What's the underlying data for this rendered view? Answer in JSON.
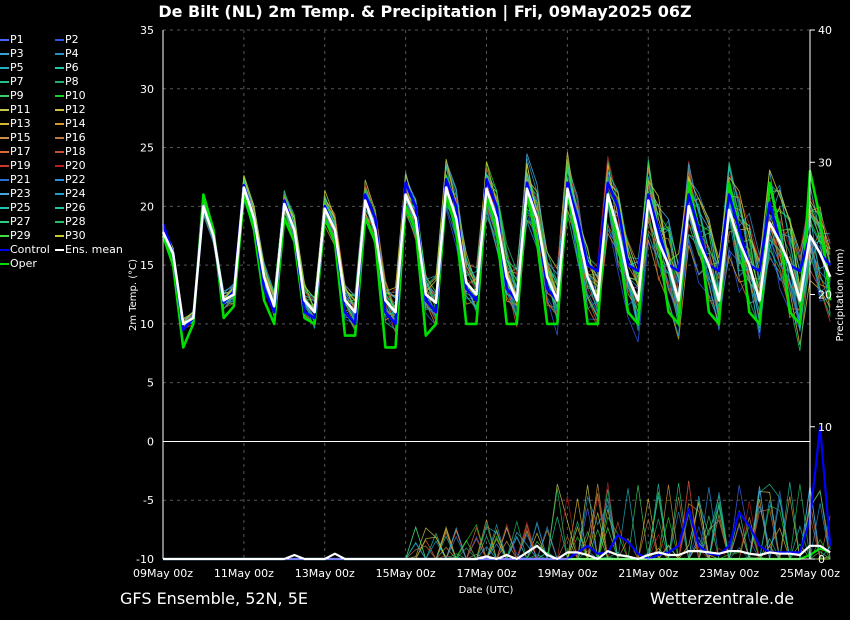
{
  "header": {
    "title": "De Bilt  (NL)  2m Temp. & Precipitation | Fri, 09May2025 06Z"
  },
  "footer": {
    "left": "GFS Ensemble, 52N, 5E",
    "right": "Wetterzentrale.de"
  },
  "legend": [
    {
      "label": "P1",
      "color": "#4466ff"
    },
    {
      "label": "P2",
      "color": "#2f55e0"
    },
    {
      "label": "P3",
      "color": "#3aa0d8"
    },
    {
      "label": "P4",
      "color": "#2b8fc4"
    },
    {
      "label": "P5",
      "color": "#20b0c0"
    },
    {
      "label": "P6",
      "color": "#22c4a8"
    },
    {
      "label": "P7",
      "color": "#20c090"
    },
    {
      "label": "P8",
      "color": "#1fb070"
    },
    {
      "label": "P9",
      "color": "#3ad060"
    },
    {
      "label": "P10",
      "color": "#20d020"
    },
    {
      "label": "P11",
      "color": "#c8c850"
    },
    {
      "label": "P12",
      "color": "#d0c040"
    },
    {
      "label": "P13",
      "color": "#d6b832"
    },
    {
      "label": "P14",
      "color": "#d09a30"
    },
    {
      "label": "P15",
      "color": "#c8904a"
    },
    {
      "label": "P16",
      "color": "#c07840"
    },
    {
      "label": "P17",
      "color": "#d86a30"
    },
    {
      "label": "P18",
      "color": "#c85030"
    },
    {
      "label": "P19",
      "color": "#c83a30"
    },
    {
      "label": "P20",
      "color": "#b82020"
    },
    {
      "label": "P21",
      "color": "#2a70d0"
    },
    {
      "label": "P22",
      "color": "#2b90e0"
    },
    {
      "label": "P23",
      "color": "#44aadd"
    },
    {
      "label": "P24",
      "color": "#1ea0c8"
    },
    {
      "label": "P25",
      "color": "#22c0b0"
    },
    {
      "label": "P26",
      "color": "#20c8a0"
    },
    {
      "label": "P27",
      "color": "#2ad080"
    },
    {
      "label": "P28",
      "color": "#20c060"
    },
    {
      "label": "P29",
      "color": "#40e040"
    },
    {
      "label": "P30",
      "color": "#c8c830"
    },
    {
      "label": "Control",
      "color": "#0000ff"
    },
    {
      "label": "Ens. mean",
      "color": "#ffffff"
    },
    {
      "label": "Oper",
      "color": "#00e000"
    }
  ],
  "chart_data": {
    "type": "line",
    "title": "De Bilt  (NL)  2m Temp. & Precipitation | Fri, 09May2025 06Z",
    "xlabel": "Date (UTC)",
    "ylabel": "2m Temp. (°C)",
    "y2label": "Precipitation (mm)",
    "ylim": [
      -10,
      35
    ],
    "y2lim": [
      0,
      40
    ],
    "yticks": [
      "35",
      "30",
      "25",
      "20",
      "15",
      "10",
      "5",
      "0",
      "-5",
      "-10"
    ],
    "y2ticks": [
      "40",
      "30",
      "20",
      "10",
      "0"
    ],
    "xlim_hours": [
      0,
      384
    ],
    "step_hours": 6,
    "xtick_labels": [
      "09May 00z",
      "11May 00z",
      "13May 00z",
      "15May 00z",
      "17May 00z",
      "19May 00z",
      "21May 00z",
      "23May 00z",
      "25May 00z"
    ],
    "grid": true,
    "legend_position": "left",
    "series": [
      {
        "name": "Ens. mean",
        "kind": "temperature",
        "color": "#ffffff",
        "values": [
          17.8,
          16,
          10,
          10.5,
          20,
          17.5,
          12,
          12.5,
          21.6,
          19,
          14,
          11.5,
          20.2,
          18,
          12,
          11,
          19.8,
          18,
          12,
          11,
          20.5,
          18,
          12,
          11,
          21,
          19,
          12.5,
          11.8,
          21.6,
          19,
          13.5,
          12.5,
          21.5,
          19,
          14,
          12,
          21.5,
          19,
          14,
          12,
          21.5,
          18,
          14,
          12,
          21,
          18,
          14,
          12,
          20.5,
          17,
          15,
          12,
          20,
          17,
          15,
          12,
          19.7,
          17,
          15,
          12,
          18.6,
          17,
          15,
          12,
          17.5,
          16,
          14
        ]
      },
      {
        "name": "Control",
        "kind": "temperature",
        "color": "#0000ff",
        "values": [
          18.5,
          16,
          9.5,
          10.5,
          20,
          17.5,
          11.8,
          12.8,
          21.8,
          19,
          13,
          11,
          20.5,
          18,
          11,
          10.5,
          20,
          18,
          11,
          10,
          21,
          19,
          11,
          10,
          22,
          20,
          12,
          11,
          22.3,
          20,
          13,
          12,
          22.3,
          20,
          13,
          12,
          22,
          19,
          13,
          12,
          22,
          19,
          15,
          14.5,
          22,
          20,
          15,
          14.5,
          21,
          18,
          15,
          14.5,
          21,
          18,
          15,
          14.5,
          21,
          18,
          15,
          14.5,
          20.3,
          17,
          15,
          14.5,
          17.5,
          16,
          15
        ]
      },
      {
        "name": "Oper",
        "kind": "temperature",
        "color": "#00e000",
        "values": [
          17.5,
          15,
          8,
          10,
          21,
          18,
          10.5,
          11.5,
          21,
          18,
          12,
          10,
          19,
          17,
          10.5,
          10,
          19,
          17,
          9,
          9,
          19,
          17,
          8,
          8,
          20,
          18,
          9,
          10,
          21,
          18,
          10,
          10,
          21,
          18,
          10,
          10,
          21,
          17,
          10,
          10,
          21,
          17,
          10,
          10,
          21,
          17,
          11,
          10,
          21,
          17,
          11,
          10,
          22,
          18,
          11,
          10,
          22,
          18,
          11,
          10,
          22,
          18,
          11,
          10,
          23,
          19,
          12
        ]
      },
      {
        "name": "Ens. mean",
        "kind": "precipitation",
        "color": "#ffffff",
        "values": [
          0,
          0,
          0,
          0,
          0,
          0,
          0,
          0,
          0,
          0,
          0,
          0,
          0,
          0.3,
          0,
          0,
          0,
          0.4,
          0,
          0,
          0,
          0,
          0,
          0,
          0,
          0,
          0,
          0,
          0,
          0,
          0,
          0,
          0.2,
          0,
          0.3,
          0,
          0.5,
          1,
          0.3,
          0,
          0.5,
          0.5,
          0.3,
          0,
          0.6,
          0.3,
          0.2,
          0,
          0.3,
          0.5,
          0.3,
          0.3,
          0.6,
          0.6,
          0.5,
          0.4,
          0.6,
          0.6,
          0.4,
          0.3,
          0.5,
          0.4,
          0.4,
          0.3,
          1,
          1,
          0.5
        ]
      },
      {
        "name": "Control",
        "kind": "precipitation",
        "color": "#0000ff",
        "values": [
          0,
          0,
          0,
          0,
          0,
          0,
          0,
          0,
          0,
          0,
          0,
          0,
          0,
          0,
          0,
          0,
          0,
          0,
          0,
          0,
          0,
          0,
          0,
          0,
          0,
          0,
          0,
          0,
          0,
          0,
          0,
          0,
          0,
          0,
          0,
          0,
          0,
          0,
          0,
          0,
          0,
          0.5,
          1,
          0.4,
          0.5,
          1.8,
          1.3,
          0.4,
          0,
          0.3,
          0.5,
          1,
          3.8,
          1,
          0.4,
          0.3,
          1,
          3.5,
          2.5,
          1,
          0.5,
          0.5,
          0.5,
          0.5,
          3,
          10,
          1
        ]
      },
      {
        "name": "Oper",
        "kind": "precipitation",
        "color": "#00e000",
        "values": [
          0,
          0,
          0,
          0,
          0,
          0,
          0,
          0,
          0,
          0,
          0,
          0,
          0,
          0,
          0,
          0,
          0,
          0,
          0,
          0,
          0,
          0,
          0,
          0,
          0,
          0,
          0,
          0,
          0,
          0,
          0,
          0,
          0,
          0,
          0,
          0,
          0,
          0,
          0,
          0,
          0,
          0,
          0,
          0,
          0,
          0,
          0,
          0,
          0,
          0,
          0,
          0,
          0,
          0,
          0,
          0,
          0,
          0,
          0,
          0,
          0,
          0,
          0,
          0,
          0.3,
          0.8,
          0.5
        ]
      }
    ]
  }
}
